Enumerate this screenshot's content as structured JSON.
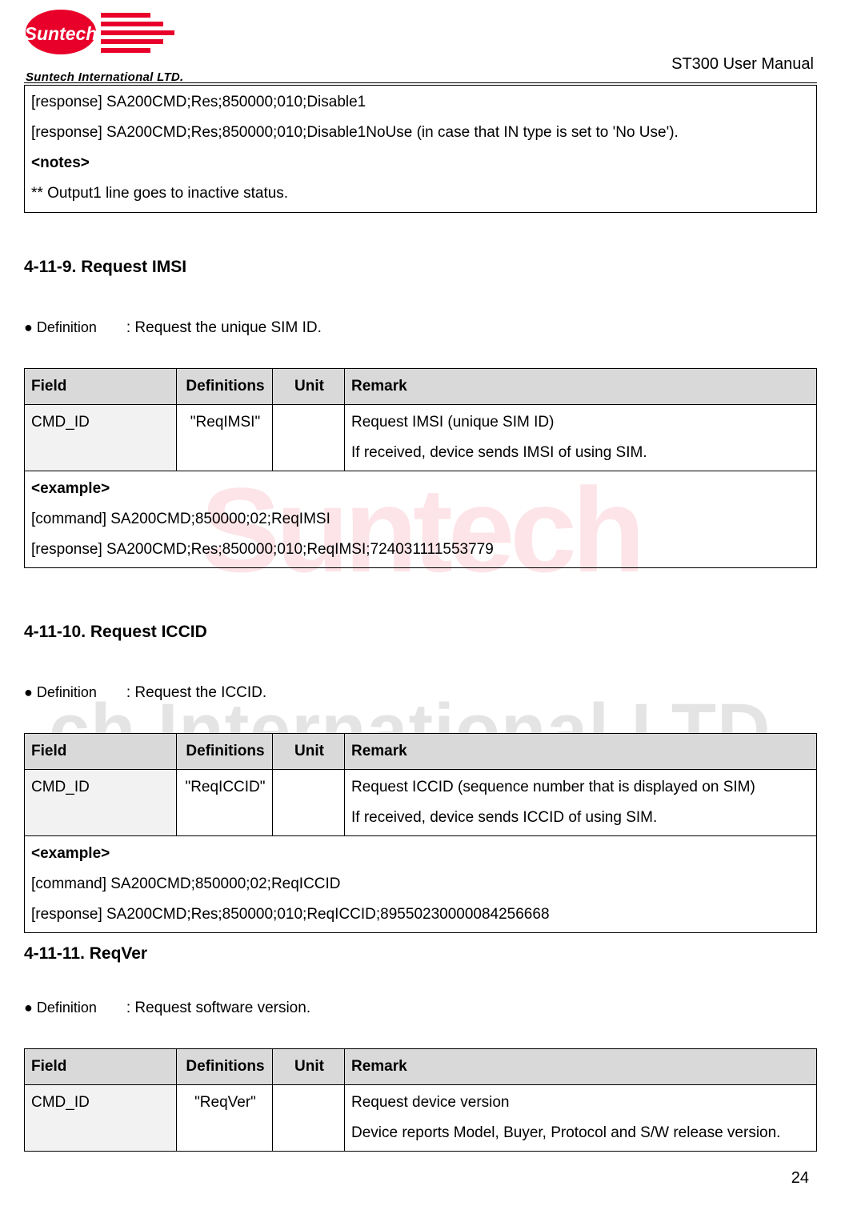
{
  "header": {
    "logo_company": "Suntech International LTD.",
    "doc_title": "ST300 User Manual"
  },
  "top_box": {
    "line1": "[response] SA200CMD;Res;850000;010;Disable1",
    "line2": "[response] SA200CMD;Res;850000;010;Disable1NoUse (in case that IN type is set to 'No Use').",
    "notes_label": "<notes>",
    "note1": "** Output1 line goes to inactive status."
  },
  "sec_imsi": {
    "title": "4-11-9. Request IMSI",
    "definition_label": "● Definition",
    "definition_text": ": Request the unique SIM ID.",
    "table": {
      "headers": {
        "field": "Field",
        "definitions": "Definitions",
        "unit": "Unit",
        "remark": "Remark"
      },
      "row": {
        "field": "CMD_ID",
        "definitions": "\"ReqIMSI\"",
        "unit": "",
        "remark_l1": "Request IMSI (unique SIM ID)",
        "remark_l2": "If received, device sends IMSI of using SIM."
      },
      "example_label": "<example>",
      "example_cmd": "[command] SA200CMD;850000;02;ReqIMSI",
      "example_res": "[response] SA200CMD;Res;850000;010;ReqIMSI;724031111553779"
    }
  },
  "sec_iccid": {
    "title": "4-11-10. Request ICCID",
    "definition_label": "● Definition",
    "definition_text": ": Request the ICCID.",
    "table": {
      "headers": {
        "field": "Field",
        "definitions": "Definitions",
        "unit": "Unit",
        "remark": "Remark"
      },
      "row": {
        "field": "CMD_ID",
        "definitions": "\"ReqICCID\"",
        "unit": "",
        "remark_l1": "Request ICCID (sequence number that is displayed on SIM)",
        "remark_l2": "If received, device sends ICCID of using SIM."
      },
      "example_label": "<example>",
      "example_cmd": "[command] SA200CMD;850000;02;ReqICCID",
      "example_res": "[response] SA200CMD;Res;850000;010;ReqICCID;89550230000084256668"
    }
  },
  "sec_reqver": {
    "title": "4-11-11. ReqVer",
    "definition_label": "● Definition",
    "definition_text": ": Request software version.",
    "table": {
      "headers": {
        "field": "Field",
        "definitions": "Definitions",
        "unit": "Unit",
        "remark": "Remark"
      },
      "row": {
        "field": "CMD_ID",
        "definitions": "\"ReqVer\"",
        "unit": "",
        "remark_l1": "Request device version",
        "remark_l2": "Device reports Model, Buyer, Protocol and S/W release version."
      }
    }
  },
  "page_number": "24"
}
